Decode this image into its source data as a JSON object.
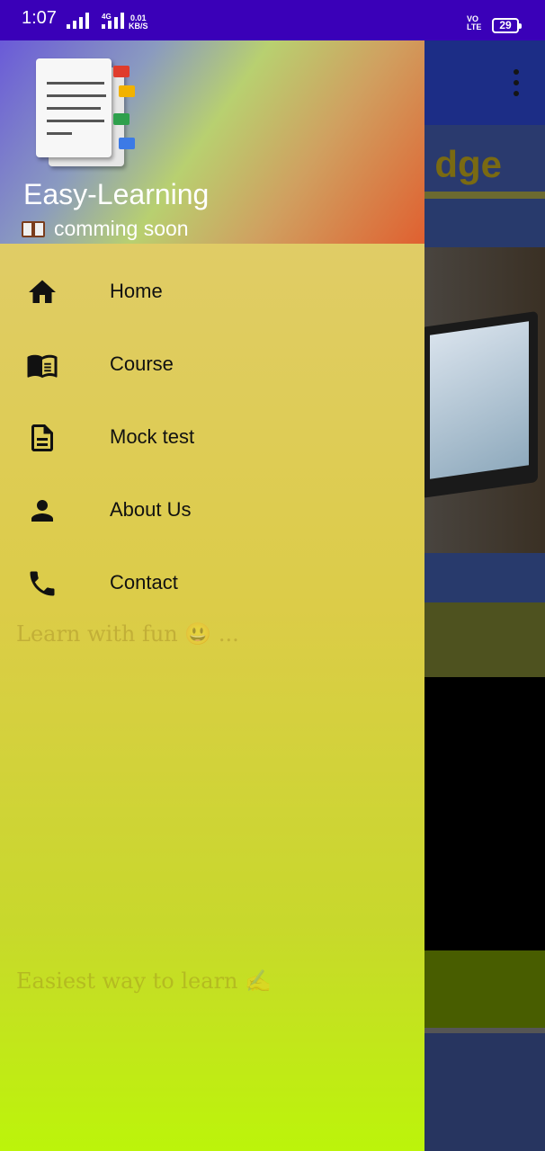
{
  "status_bar": {
    "time": "1:07",
    "network_type": "4G",
    "speed_value": "0.01",
    "speed_unit": "KB/S",
    "volte_line1": "VO",
    "volte_line2": "LTE",
    "battery": "29",
    "icons": [
      "signal-icon",
      "signal-icon",
      "volte-icon",
      "battery-icon"
    ]
  },
  "drawer": {
    "app_name": "Easy-Learning",
    "subtitle": "comming soon",
    "menu": [
      {
        "label": "Home",
        "icon": "home-icon"
      },
      {
        "label": "Course",
        "icon": "book-open-icon"
      },
      {
        "label": "Mock test",
        "icon": "document-icon"
      },
      {
        "label": "About Us",
        "icon": "person-icon"
      },
      {
        "label": "Contact",
        "icon": "phone-icon"
      }
    ]
  },
  "background_app": {
    "banner_title_fragment": "dge",
    "section_text": "Learn with fun 😃 ...",
    "section_text_2": "Easiest way to learn ✍"
  },
  "colors": {
    "status_bar": "#3a00b8",
    "toolbar": "#1c2d86",
    "drawer_body_top": "#e0cc66",
    "drawer_body_bottom": "#bcf40a"
  }
}
